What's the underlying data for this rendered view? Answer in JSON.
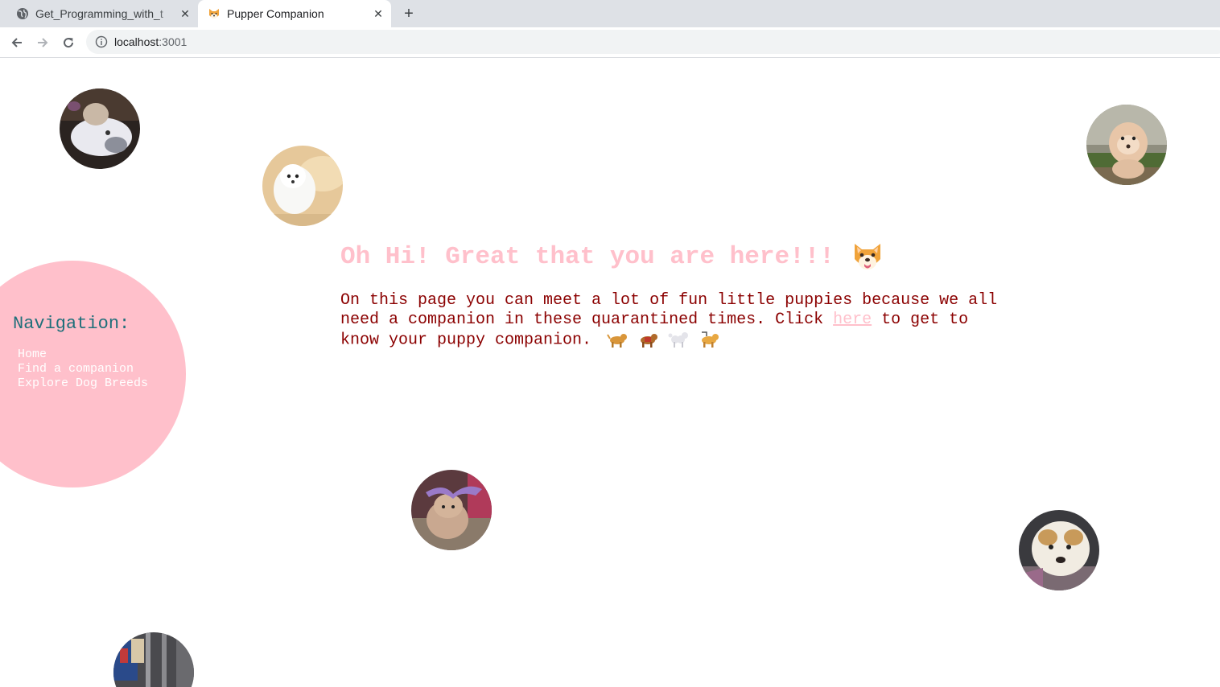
{
  "browser": {
    "tabs": [
      {
        "title": "Get_Programming_with_t",
        "favicon": "globe-icon",
        "active": false
      },
      {
        "title": "Pupper Companion",
        "favicon": "dog-face-icon",
        "active": true
      }
    ],
    "address": {
      "host": "localhost",
      "port": ":3001"
    }
  },
  "navigation": {
    "title": "Navigation:",
    "items": [
      "Home",
      "Find a companion",
      "Explore Dog Breeds"
    ]
  },
  "main": {
    "headline": "Oh Hi! Great that you are here!!!",
    "intro_before_link": "On this page you can meet a lot of fun little puppies because we all need a companion in these quarantined times. Click ",
    "link_text": "here",
    "intro_after_link": " to get to know your puppy companion."
  },
  "colors": {
    "nav_circle": "#ffc0cb",
    "nav_title": "#1f6f7a",
    "headline": "#ffc0cb",
    "body_text": "#8b0000",
    "link": "#ffc0cb"
  },
  "icons": {
    "headline_emoji": "dog-face-icon",
    "dog_row": [
      "dog-icon",
      "service-dog-icon",
      "poodle-icon",
      "guide-dog-icon"
    ],
    "puppy_photos": [
      "puppy-photo-1",
      "puppy-photo-2",
      "puppy-photo-3",
      "puppy-photo-4",
      "puppy-photo-5",
      "puppy-photo-6"
    ]
  }
}
